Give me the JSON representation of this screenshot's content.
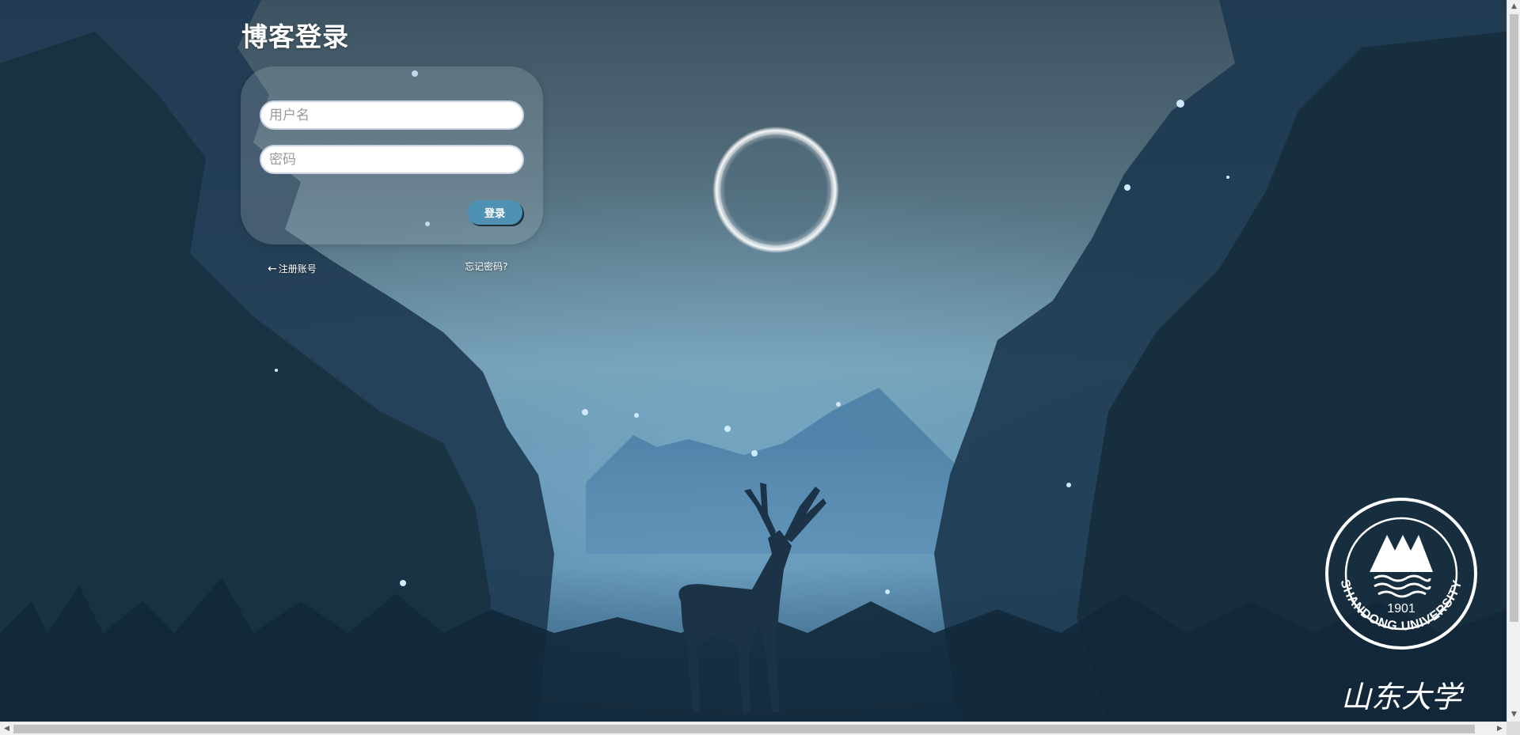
{
  "login": {
    "title": "博客登录",
    "username_placeholder": "用户名",
    "password_placeholder": "密码",
    "submit_label": "登录",
    "register_arrow": "←",
    "register_label": "注册账号",
    "forgot_label": "忘记密码?"
  },
  "emblem": {
    "university_name_en": "SHANDONG UNIVERSITY",
    "founded_year": "1901",
    "calligraphy": "山东大学"
  },
  "icons": {
    "background": "night-forest-deer-illustration",
    "emblem": "shandong-university-emblem"
  },
  "colors": {
    "button": "#4e91b3",
    "card": "rgba(160,175,185,0.28)",
    "text": "#ffffff"
  }
}
